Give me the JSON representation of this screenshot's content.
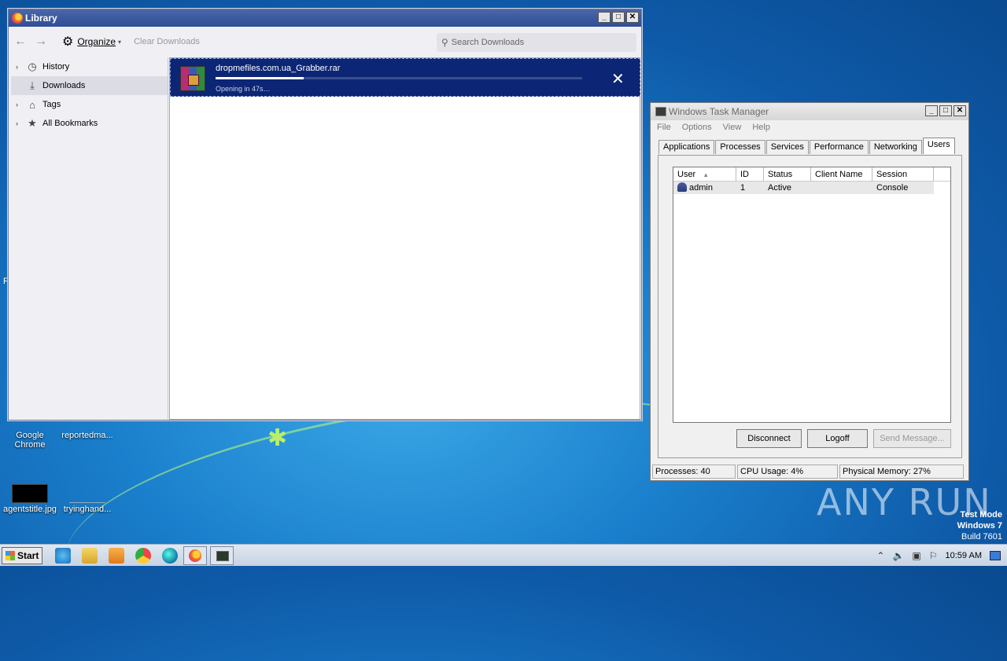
{
  "library": {
    "title": "Library",
    "organize_label": "Organize",
    "clear_downloads_label": "Clear Downloads",
    "search_placeholder": "Search Downloads",
    "sidebar": [
      {
        "label": "History",
        "icon": "clock-icon"
      },
      {
        "label": "Downloads",
        "icon": "download-icon"
      },
      {
        "label": "Tags",
        "icon": "tag-icon"
      },
      {
        "label": "All Bookmarks",
        "icon": "star-icon"
      }
    ],
    "download": {
      "filename": "dropmefiles.com.ua_Grabber.rar",
      "status": "Opening in 47s…",
      "progress": 0.24
    }
  },
  "task_manager": {
    "title": "Windows Task Manager",
    "menu": [
      "File",
      "Options",
      "View",
      "Help"
    ],
    "tabs": [
      "Applications",
      "Processes",
      "Services",
      "Performance",
      "Networking",
      "Users"
    ],
    "active_tab": "Users",
    "columns": [
      "User",
      "ID",
      "Status",
      "Client Name",
      "Session"
    ],
    "rows": [
      {
        "user": "admin",
        "id": "1",
        "status": "Active",
        "client_name": "",
        "session": "Console"
      }
    ],
    "buttons": {
      "disconnect": "Disconnect",
      "logoff": "Logoff",
      "send_message": "Send Message..."
    },
    "status": {
      "processes": "Processes: 40",
      "cpu": "CPU Usage: 4%",
      "memory": "Physical Memory: 27%"
    }
  },
  "desktop": {
    "icons": [
      {
        "label": "Google Chrome"
      },
      {
        "label": "reportedma..."
      },
      {
        "label": "agentstitle.jpg"
      },
      {
        "label": "tryinghand..."
      }
    ],
    "stray_char": "F"
  },
  "watermark": {
    "brand": "ANY RUN",
    "test_mode": "Test Mode",
    "os": "Windows 7",
    "build": "Build 7601"
  },
  "taskbar": {
    "start_label": "Start",
    "clock": "10:59 AM"
  }
}
